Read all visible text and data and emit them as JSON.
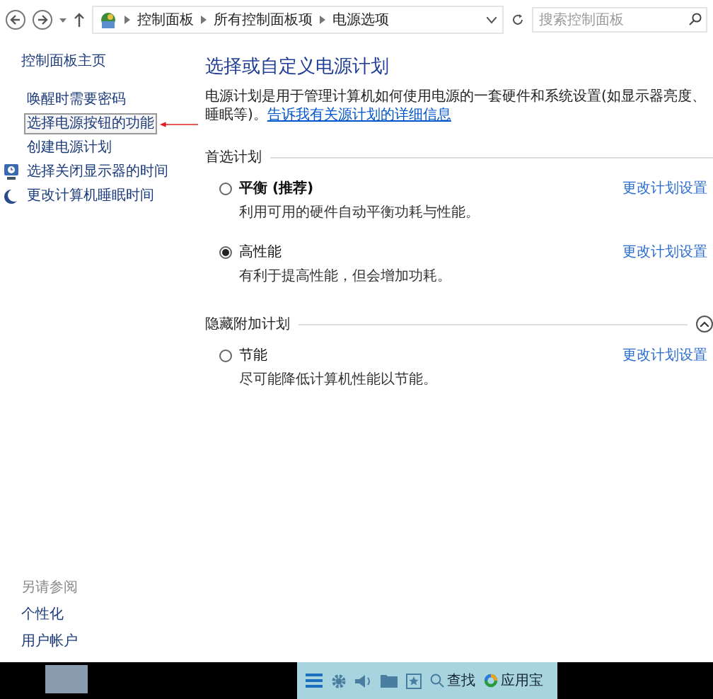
{
  "address_bar": {
    "breadcrumbs": [
      "控制面板",
      "所有控制面板项",
      "电源选项"
    ],
    "search": {
      "placeholder": "搜索控制面板"
    }
  },
  "sidebar": {
    "home": "控制面板主页",
    "items": [
      {
        "label": "唤醒时需要密码",
        "kind": "plain",
        "selected": false
      },
      {
        "label": "选择电源按钮的功能",
        "kind": "plain",
        "selected": true
      },
      {
        "label": "创建电源计划",
        "kind": "plain",
        "selected": false
      },
      {
        "label": "选择关闭显示器的时间",
        "kind": "display",
        "selected": false
      },
      {
        "label": "更改计算机睡眠时间",
        "kind": "sleep",
        "selected": false
      }
    ],
    "see_also": {
      "heading": "另请参阅",
      "links": [
        "个性化",
        "用户帐户"
      ]
    }
  },
  "main": {
    "title": "选择或自定义电源计划",
    "description": "电源计划是用于管理计算机如何使用电源的一套硬件和系统设置(如显示器亮度、睡眠等)。",
    "link_parts": [
      "告诉我有关",
      "源计划的详细信息"
    ],
    "sections": [
      {
        "heading": "首选计划",
        "collapsible": false,
        "plans": [
          {
            "name": "平衡 (推荐)",
            "recommended": true,
            "selected": false,
            "description": "利用可用的硬件自动平衡功耗与性能。",
            "link": "更改计划设置"
          },
          {
            "name": "高性能",
            "recommended": false,
            "selected": true,
            "description": "有利于提高性能，但会增加功耗。",
            "link": "更改计划设置"
          }
        ]
      },
      {
        "heading": "隐藏附加计划",
        "collapsible": true,
        "plans": [
          {
            "name": "节能",
            "recommended": false,
            "selected": false,
            "description": "尽可能降低计算机性能以节能。",
            "link": "更改计划设置"
          }
        ]
      }
    ]
  },
  "taskbar": {
    "tools": [
      {
        "kind": "menu"
      },
      {
        "kind": "gear"
      },
      {
        "kind": "speaker"
      },
      {
        "kind": "folder"
      },
      {
        "kind": "star"
      }
    ],
    "search_label": "查找",
    "app_label": "应用宝"
  }
}
